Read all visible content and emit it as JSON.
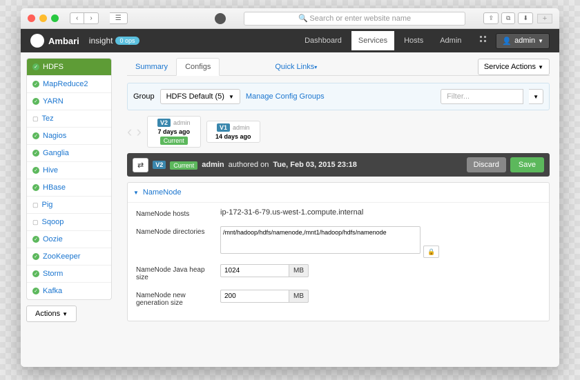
{
  "browser": {
    "placeholder": "Search or enter website name"
  },
  "nav": {
    "brand": "Ambari",
    "cluster": "insight",
    "ops": "0 ops",
    "items": [
      "Dashboard",
      "Services",
      "Hosts",
      "Admin"
    ],
    "user": "admin"
  },
  "sidebar": {
    "items": [
      {
        "label": "HDFS",
        "icon": "ok",
        "active": true
      },
      {
        "label": "MapReduce2",
        "icon": "ok"
      },
      {
        "label": "YARN",
        "icon": "ok"
      },
      {
        "label": "Tez",
        "icon": "cli"
      },
      {
        "label": "Nagios",
        "icon": "ok"
      },
      {
        "label": "Ganglia",
        "icon": "ok"
      },
      {
        "label": "Hive",
        "icon": "ok"
      },
      {
        "label": "HBase",
        "icon": "ok"
      },
      {
        "label": "Pig",
        "icon": "cli"
      },
      {
        "label": "Sqoop",
        "icon": "cli"
      },
      {
        "label": "Oozie",
        "icon": "ok"
      },
      {
        "label": "ZooKeeper",
        "icon": "ok"
      },
      {
        "label": "Storm",
        "icon": "ok"
      },
      {
        "label": "Kafka",
        "icon": "ok"
      }
    ],
    "actions": "Actions"
  },
  "tabs": {
    "summary": "Summary",
    "configs": "Configs",
    "quicklinks": "Quick Links",
    "service_actions": "Service Actions"
  },
  "group": {
    "label": "Group",
    "selected": "HDFS Default (5)",
    "manage": "Manage Config Groups",
    "filter": "Filter..."
  },
  "versions": [
    {
      "v": "V2",
      "author": "admin",
      "time": "7 days ago",
      "current": true
    },
    {
      "v": "V1",
      "author": "admin",
      "time": "14 days ago",
      "current": false
    }
  ],
  "bar": {
    "v": "V2",
    "current": "Current",
    "author": "admin",
    "text": "authored on",
    "date": "Tue, Feb 03, 2015 23:18",
    "discard": "Discard",
    "save": "Save"
  },
  "section": {
    "title": "NameNode",
    "rows": [
      {
        "label": "NameNode hosts",
        "type": "text",
        "value": "ip-172-31-6-79.us-west-1.compute.internal"
      },
      {
        "label": "NameNode directories",
        "type": "textarea",
        "value": "/mnt/hadoop/hdfs/namenode,/mnt1/hadoop/hdfs/namenode"
      },
      {
        "label": "NameNode Java heap size",
        "type": "unit",
        "value": "1024",
        "unit": "MB"
      },
      {
        "label": "NameNode new generation size",
        "type": "unit",
        "value": "200",
        "unit": "MB"
      }
    ]
  }
}
